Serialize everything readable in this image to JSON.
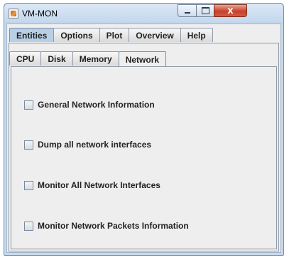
{
  "window": {
    "title": "VM-MON",
    "icon": "java-app-icon",
    "close_glyph": "x"
  },
  "tabs": {
    "outer": [
      "Entities",
      "Options",
      "Plot",
      "Overview",
      "Help"
    ],
    "outer_active": "Entities",
    "inner": [
      "CPU",
      "Disk",
      "Memory",
      "Network"
    ],
    "inner_active": "Network"
  },
  "options": [
    {
      "label": "General Network Information",
      "checked": false
    },
    {
      "label": "Dump all network interfaces",
      "checked": false
    },
    {
      "label": "Monitor All Network Interfaces",
      "checked": false
    },
    {
      "label": "Monitor Network Packets Information",
      "checked": false
    }
  ],
  "colors": {
    "title_bar": "#c6d9ee",
    "close_button": "#c8402a",
    "panel_bg": "#eeeeee"
  }
}
